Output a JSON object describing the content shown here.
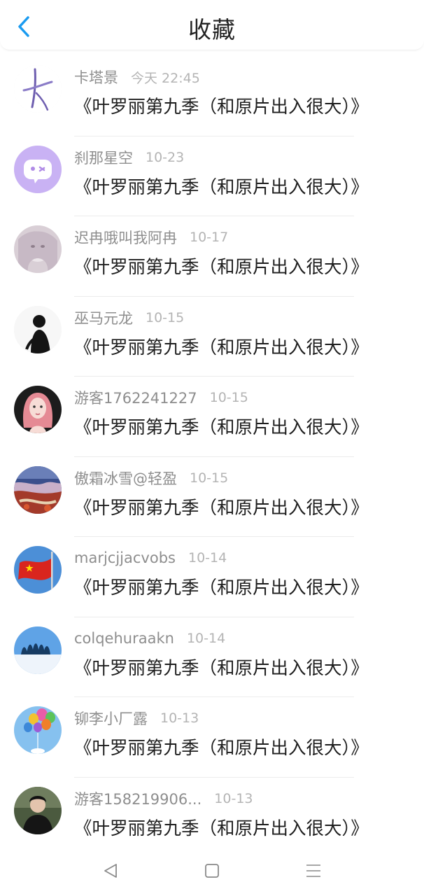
{
  "header": {
    "title": "收藏"
  },
  "items": [
    {
      "name": "卡塔景",
      "time": "今天 22:45",
      "title": "《叶罗丽第九季（和原片出入很大）》"
    },
    {
      "name": "刹那星空",
      "time": "10-23",
      "title": "《叶罗丽第九季（和原片出入很大）》"
    },
    {
      "name": "迟冉哦叫我阿冉",
      "time": "10-17",
      "title": "《叶罗丽第九季（和原片出入很大）》"
    },
    {
      "name": "巫马元龙",
      "time": "10-15",
      "title": "《叶罗丽第九季（和原片出入很大）》"
    },
    {
      "name": "游客1762241227",
      "time": "10-15",
      "title": "《叶罗丽第九季（和原片出入很大）》"
    },
    {
      "name": "傲霜冰雪@轻盈",
      "time": "10-15",
      "title": "《叶罗丽第九季（和原片出入很大）》"
    },
    {
      "name": "marjcjjacvobs",
      "time": "10-14",
      "title": "《叶罗丽第九季（和原片出入很大）》"
    },
    {
      "name": "colqehuraakn",
      "time": "10-14",
      "title": "《叶罗丽第九季（和原片出入很大）》"
    },
    {
      "name": "铆李小厂露",
      "time": "10-13",
      "title": "《叶罗丽第九季（和原片出入很大）》"
    },
    {
      "name": "游客158219906...",
      "time": "10-13",
      "title": "《叶罗丽第九季（和原片出入很大）》"
    }
  ],
  "icons": {
    "back": "chevron-left-icon",
    "nav_back": "triangle-back-icon",
    "nav_home": "square-home-icon",
    "nav_menu": "menu-lines-icon"
  },
  "colors": {
    "accent": "#1a9bf0"
  }
}
